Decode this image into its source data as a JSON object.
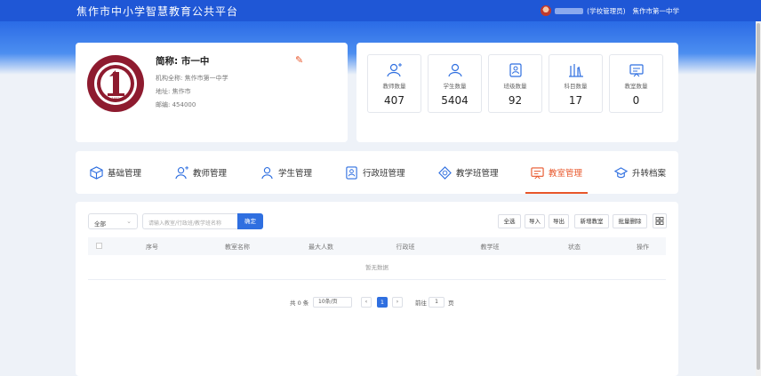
{
  "header": {
    "title": "焦作市中小学智慧教育公共平台",
    "user_role": "(学校管理员)",
    "school_name": "焦作市第一中学"
  },
  "school": {
    "short_name": "简称: 市一中",
    "full_name": "机构全称: 焦作市第一中学",
    "address": "地址: 焦作市",
    "postcode": "邮编: 454000"
  },
  "stats": [
    {
      "label": "教师数量",
      "value": "407",
      "icon": "teacher-icon"
    },
    {
      "label": "学生数量",
      "value": "5404",
      "icon": "student-icon"
    },
    {
      "label": "班级数量",
      "value": "92",
      "icon": "class-icon"
    },
    {
      "label": "科目数量",
      "value": "17",
      "icon": "subject-icon"
    },
    {
      "label": "教室数量",
      "value": "0",
      "icon": "classroom-icon"
    }
  ],
  "tabs": [
    {
      "label": "基础管理",
      "icon": "cube-icon"
    },
    {
      "label": "教师管理",
      "icon": "teacher-icon"
    },
    {
      "label": "学生管理",
      "icon": "student-icon"
    },
    {
      "label": "行政班管理",
      "icon": "class-icon"
    },
    {
      "label": "教学班管理",
      "icon": "teaching-class-icon"
    },
    {
      "label": "教室管理",
      "icon": "classroom-icon",
      "active": true
    },
    {
      "label": "升转档案",
      "icon": "graduation-icon"
    }
  ],
  "toolbar": {
    "filter_value": "全部",
    "search_placeholder": "请输入教室/行政班/教学班名称",
    "confirm_label": "确定",
    "select_all": "全选",
    "import": "导入",
    "export": "导出",
    "add_classroom": "新增教室",
    "batch_delete": "批量删除"
  },
  "table": {
    "columns": [
      "序号",
      "教室名称",
      "最大人数",
      "行政班",
      "教学班",
      "状态",
      "操作"
    ],
    "empty_text": "暂无数据"
  },
  "pagination": {
    "total": "共 0 条",
    "page_size": "10条/页",
    "current_page": "1",
    "goto_prefix": "前往",
    "goto_value": "1",
    "goto_suffix": "页"
  },
  "colors": {
    "primary": "#2f6fe0",
    "header": "#1f57d6",
    "accent": "#e8562a"
  }
}
